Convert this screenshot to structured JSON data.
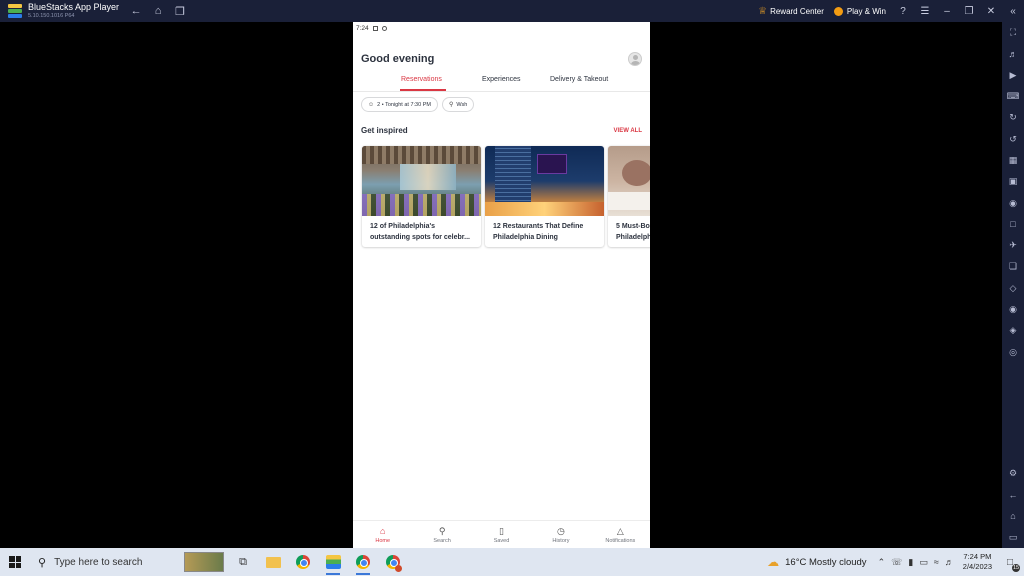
{
  "window": {
    "app_title": "BlueStacks App Player",
    "version": "5.10.150.1016  P64",
    "reward_center": "Reward Center",
    "play_win": "Play & Win"
  },
  "status_bar": {
    "time": "7:24"
  },
  "header": {
    "greeting": "Good evening"
  },
  "tabs": [
    {
      "label": "Reservations",
      "active": true
    },
    {
      "label": "Experiences",
      "active": false
    },
    {
      "label": "Delivery & Takeout",
      "active": false
    }
  ],
  "chips": {
    "party": "2 • Tonight at 7:30 PM",
    "location": "Wsh"
  },
  "inspired": {
    "title": "Get inspired",
    "view_all": "VIEW ALL",
    "cards": [
      {
        "line1": "12 of Philadelphia's",
        "line2": "outstanding spots for celebr..."
      },
      {
        "line1": "12 Restaurants That Define",
        "line2": "Philadelphia Dining"
      },
      {
        "line1": "5 Must-Bo",
        "line2": "Philadelph"
      }
    ]
  },
  "bottom_nav": [
    {
      "label": "Home",
      "icon": "home-icon",
      "active": true
    },
    {
      "label": "Search",
      "icon": "search-icon",
      "active": false
    },
    {
      "label": "Saved",
      "icon": "bookmark-icon",
      "active": false
    },
    {
      "label": "History",
      "icon": "clock-icon",
      "active": false
    },
    {
      "label": "Notifications",
      "icon": "bell-icon",
      "active": false
    }
  ],
  "taskbar": {
    "search_placeholder": "Type here to search",
    "weather": "16°C  Mostly cloudy",
    "time": "7:24 PM",
    "date": "2/4/2023",
    "notification_count": "15"
  },
  "colors": {
    "accent": "#da3743",
    "bluestacks_bar": "#1a2038",
    "taskbar": "#dfe6f1"
  }
}
